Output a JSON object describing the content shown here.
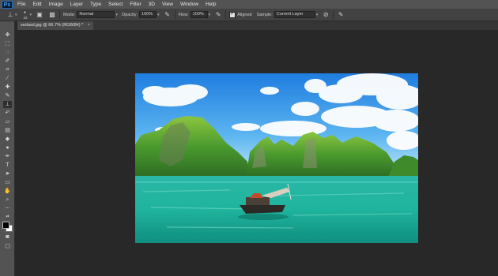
{
  "app": {
    "logo": "Ps"
  },
  "menu": [
    "File",
    "Edit",
    "Image",
    "Layer",
    "Type",
    "Select",
    "Filter",
    "3D",
    "View",
    "Window",
    "Help"
  ],
  "options": {
    "brush_size": "42",
    "mode_label": "Mode:",
    "mode_value": "Normal",
    "opacity_label": "Opacity:",
    "opacity_value": "100%",
    "flow_label": "Flow:",
    "flow_value": "100%",
    "aligned_label": "Aligned",
    "sample_label": "Sample:",
    "sample_value": "Current Layer"
  },
  "document": {
    "tab_title": "sedasd.jpg @ 66.7% (RGB/8#) *",
    "close": "×"
  },
  "tools": [
    "move-tool-icon",
    "marquee-tool-icon",
    "lasso-tool-icon",
    "quick-select-tool-icon",
    "crop-tool-icon",
    "eyedropper-tool-icon",
    "healing-brush-icon",
    "brush-tool-icon",
    "clone-stamp-icon",
    "history-brush-icon",
    "eraser-tool-icon",
    "gradient-tool-icon",
    "blur-tool-icon",
    "dodge-tool-icon",
    "pen-tool-icon",
    "type-tool-icon",
    "path-select-icon",
    "rectangle-tool-icon",
    "hand-tool-icon",
    "zoom-tool-icon",
    "more-tools-icon"
  ],
  "colors": {
    "foreground": "#000000",
    "background": "#ffffff",
    "ui_dark": "#282828",
    "ui_panel": "#535353"
  }
}
